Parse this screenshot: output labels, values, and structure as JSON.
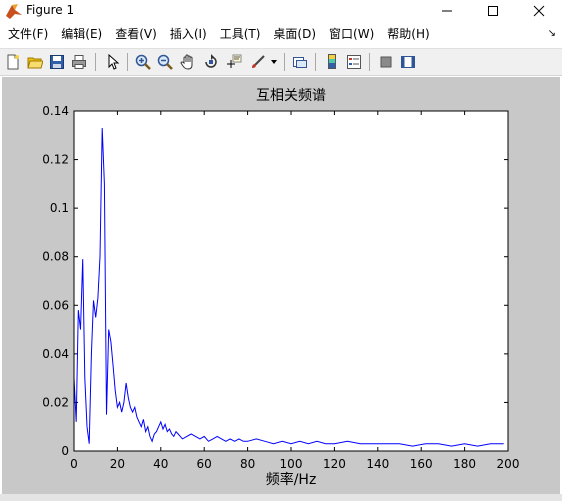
{
  "window": {
    "title": "Figure 1",
    "minimize_icon": "minimize-icon",
    "maximize_icon": "maximize-icon",
    "close_icon": "close-icon"
  },
  "menu": {
    "items": [
      "文件(F)",
      "编辑(E)",
      "查看(V)",
      "插入(I)",
      "工具(T)",
      "桌面(D)",
      "窗口(W)",
      "帮助(H)"
    ],
    "dock_glyph": "↘"
  },
  "toolbar": {
    "icons": [
      "new-figure-icon",
      "open-file-icon",
      "save-icon",
      "print-icon",
      "edit-plot-icon",
      "zoom-in-icon",
      "zoom-out-icon",
      "pan-icon",
      "rotate-3d-icon",
      "data-cursor-icon",
      "brush-icon",
      "link-plot-icon",
      "colorbar-icon",
      "legend-icon",
      "hide-plot-tools-icon",
      "show-plot-tools-icon"
    ]
  },
  "colors": {
    "line": "#0000ff",
    "figure_bg": "#c8c8c8",
    "axes_bg": "#ffffff"
  },
  "chart_data": {
    "type": "line",
    "title": "互相关频谱",
    "xlabel": "频率/Hz",
    "ylabel": "",
    "xlim": [
      0,
      200
    ],
    "ylim": [
      0,
      0.14
    ],
    "xticks": [
      0,
      20,
      40,
      60,
      80,
      100,
      120,
      140,
      160,
      180,
      200
    ],
    "yticks": [
      0,
      0.02,
      0.04,
      0.06,
      0.08,
      0.1,
      0.12,
      0.14
    ],
    "xtick_labels": [
      "0",
      "20",
      "40",
      "60",
      "80",
      "100",
      "120",
      "140",
      "160",
      "180",
      "200"
    ],
    "ytick_labels": [
      "0",
      "0.02",
      "0.04",
      "0.06",
      "0.08",
      "0.1",
      "0.12",
      "0.14"
    ],
    "grid": false,
    "series": [
      {
        "color": "#0000ff",
        "x": [
          0,
          1,
          2,
          3,
          4,
          5,
          6,
          7,
          8,
          9,
          10,
          11,
          12,
          13,
          14,
          15,
          16,
          17,
          18,
          19,
          20,
          21,
          22,
          23,
          24,
          25,
          26,
          27,
          28,
          29,
          30,
          31,
          32,
          33,
          34,
          35,
          36,
          37,
          38,
          39,
          40,
          41,
          42,
          43,
          44,
          45,
          46,
          47,
          48,
          49,
          50,
          52,
          54,
          56,
          58,
          60,
          62,
          64,
          66,
          68,
          70,
          72,
          74,
          76,
          78,
          80,
          84,
          88,
          92,
          96,
          100,
          104,
          108,
          112,
          116,
          120,
          126,
          132,
          138,
          144,
          150,
          156,
          162,
          168,
          174,
          180,
          186,
          192,
          198
        ],
        "y": [
          0.03,
          0.012,
          0.058,
          0.05,
          0.079,
          0.03,
          0.01,
          0.003,
          0.04,
          0.062,
          0.055,
          0.063,
          0.08,
          0.133,
          0.11,
          0.015,
          0.05,
          0.045,
          0.035,
          0.025,
          0.018,
          0.02,
          0.016,
          0.02,
          0.028,
          0.022,
          0.018,
          0.016,
          0.018,
          0.014,
          0.012,
          0.01,
          0.013,
          0.008,
          0.01,
          0.006,
          0.004,
          0.007,
          0.008,
          0.01,
          0.012,
          0.009,
          0.011,
          0.008,
          0.009,
          0.007,
          0.006,
          0.008,
          0.007,
          0.006,
          0.005,
          0.006,
          0.007,
          0.006,
          0.005,
          0.006,
          0.004,
          0.005,
          0.006,
          0.005,
          0.004,
          0.005,
          0.004,
          0.005,
          0.004,
          0.004,
          0.005,
          0.004,
          0.003,
          0.004,
          0.003,
          0.004,
          0.003,
          0.004,
          0.003,
          0.003,
          0.004,
          0.003,
          0.003,
          0.003,
          0.003,
          0.002,
          0.003,
          0.003,
          0.002,
          0.003,
          0.002,
          0.003,
          0.003
        ]
      }
    ]
  }
}
